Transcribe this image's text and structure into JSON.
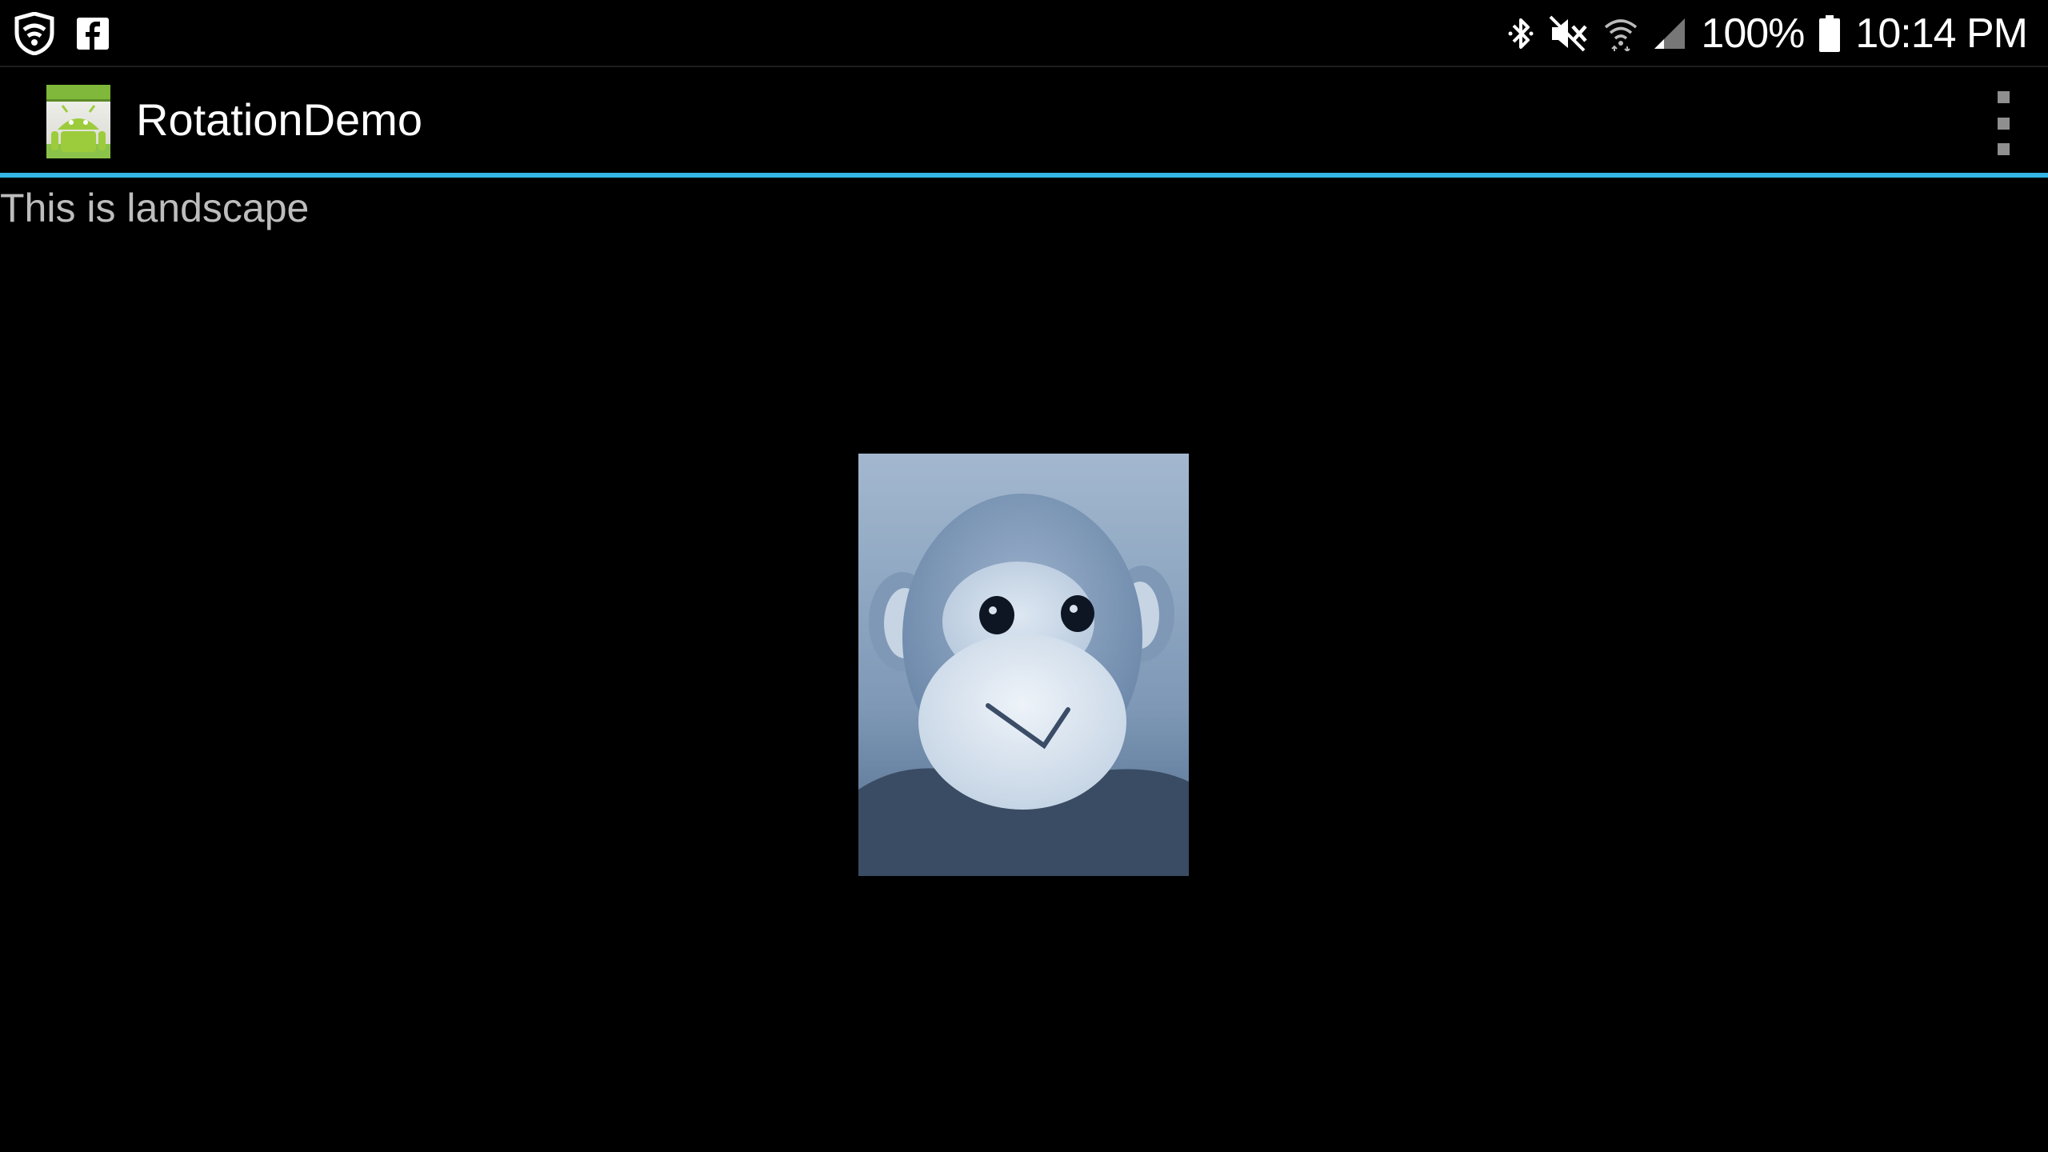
{
  "status_bar": {
    "icons_left": [
      "shield-wifi-icon",
      "facebook-icon"
    ],
    "icons_right": [
      "bluetooth-icon",
      "mute-icon",
      "wifi-icon",
      "cell-signal-icon",
      "battery-icon"
    ],
    "battery_percent": "100%",
    "time": "10:14 PM"
  },
  "action_bar": {
    "app_icon": "android-app-icon",
    "app_title": "RotationDemo",
    "overflow_icon": "overflow-menu-icon",
    "divider_color": "#33b5e5"
  },
  "content": {
    "orientation_text": "This is landscape",
    "image": "monkey-plush-photo"
  }
}
